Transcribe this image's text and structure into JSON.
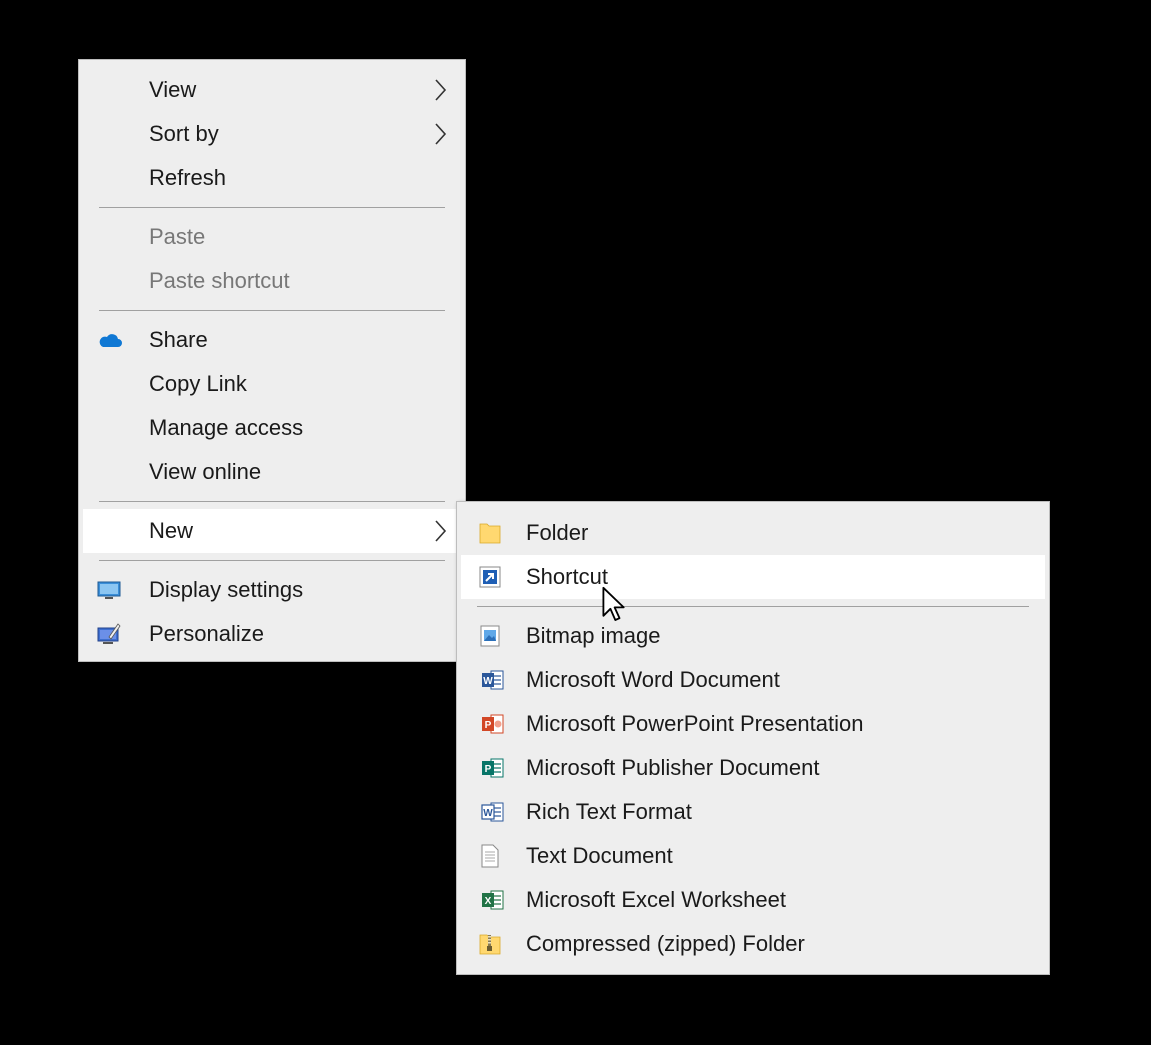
{
  "context_menu": {
    "items": [
      {
        "label": "View",
        "has_submenu": true
      },
      {
        "label": "Sort by",
        "has_submenu": true
      },
      {
        "label": "Refresh"
      },
      {
        "label": "Paste",
        "disabled": true
      },
      {
        "label": "Paste shortcut",
        "disabled": true
      },
      {
        "label": "Share",
        "icon": "onedrive-cloud-icon"
      },
      {
        "label": "Copy Link"
      },
      {
        "label": "Manage access"
      },
      {
        "label": "View online"
      },
      {
        "label": "New",
        "has_submenu": true,
        "state": "open"
      },
      {
        "label": "Display settings",
        "icon": "display-settings-icon"
      },
      {
        "label": "Personalize",
        "icon": "personalize-icon"
      }
    ]
  },
  "new_submenu": {
    "items": [
      {
        "label": "Folder",
        "icon": "folder-icon"
      },
      {
        "label": "Shortcut",
        "icon": "shortcut-icon",
        "state": "hovered"
      },
      {
        "label": "Bitmap image",
        "icon": "bitmap-image-icon"
      },
      {
        "label": "Microsoft Word Document",
        "icon": "word-document-icon"
      },
      {
        "label": "Microsoft PowerPoint Presentation",
        "icon": "powerpoint-presentation-icon"
      },
      {
        "label": "Microsoft Publisher Document",
        "icon": "publisher-document-icon"
      },
      {
        "label": "Rich Text Format",
        "icon": "rich-text-format-icon"
      },
      {
        "label": "Text Document",
        "icon": "text-document-icon"
      },
      {
        "label": "Microsoft Excel Worksheet",
        "icon": "excel-worksheet-icon"
      },
      {
        "label": "Compressed (zipped) Folder",
        "icon": "zipped-folder-icon"
      }
    ]
  },
  "colors": {
    "desktop_background": "#000000",
    "menu_background": "#eeeeee",
    "selected_item": "#ffffff",
    "disabled_text": "#777777",
    "onedrive_blue": "#0f78d4",
    "word_blue": "#2b579a",
    "powerpoint_red": "#d24726",
    "publisher_teal": "#077568",
    "excel_green": "#217346",
    "folder_yellow": "#ffd870"
  }
}
